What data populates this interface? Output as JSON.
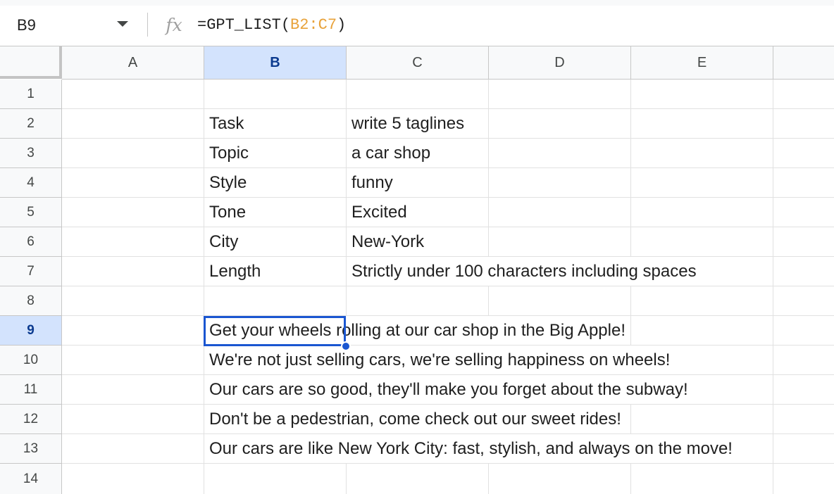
{
  "name_box": {
    "value": "B9"
  },
  "formula": {
    "prefix": "=GPT_LIST(",
    "range": "B2:C7",
    "suffix": ")"
  },
  "fx_label": "fx",
  "columns": [
    "A",
    "B",
    "C",
    "D",
    "E"
  ],
  "selected_column": "B",
  "rows": [
    "1",
    "2",
    "3",
    "4",
    "5",
    "6",
    "7",
    "8",
    "9",
    "10",
    "11",
    "12",
    "13",
    "14"
  ],
  "selected_row": "9",
  "params": [
    {
      "label": "Task",
      "value": "write 5 taglines"
    },
    {
      "label": "Topic",
      "value": "a car shop"
    },
    {
      "label": "Style",
      "value": "funny"
    },
    {
      "label": "Tone",
      "value": "Excited"
    },
    {
      "label": "City",
      "value": "New-York"
    },
    {
      "label": "Length",
      "value": "Strictly under 100 characters including spaces"
    }
  ],
  "results": [
    "Get your wheels rolling at our car shop in the Big Apple!",
    "We're not just selling cars, we're selling happiness on wheels!",
    "Our cars are so good, they'll make you forget about the subway!",
    "Don't be a pedestrian, come check out our sweet rides!",
    "Our cars are like New York City: fast, stylish, and always on the move!"
  ],
  "colors": {
    "selection": "#1a56d1",
    "header_selected": "#d3e3fd",
    "formula_range": "#e8a23a"
  }
}
